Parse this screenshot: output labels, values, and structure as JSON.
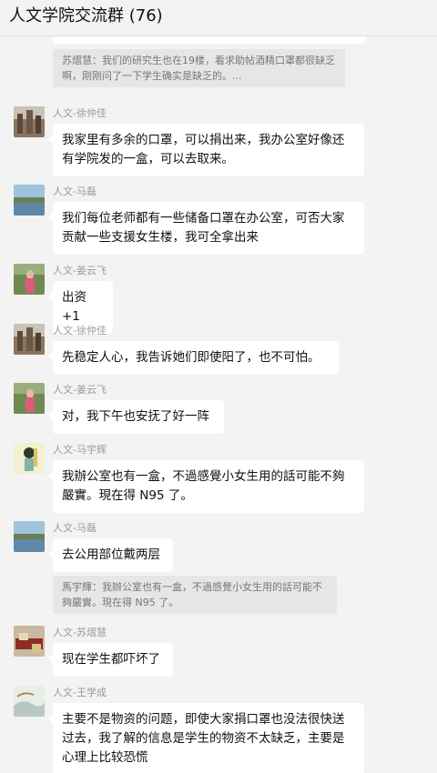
{
  "header": {
    "title": "人文学院交流群 (76)"
  },
  "quote_top": "苏熠慧：我们的研究生也在19楼，看求助帖酒精口罩都很缺乏啊，刚刚问了一下学生确实是缺乏的。...",
  "messages": [
    {
      "sender": "人文-徐仲佳",
      "text": "我家里有多余的口罩，可以捐出来，我办公室好像还有学院发的一盒，可以去取来。"
    },
    {
      "sender": "人文-马磊",
      "text": "我们每位老师都有一些储备口罩在办公室，可否大家贡献一些支援女生楼，我可全拿出来"
    },
    {
      "sender": "人文-姜云飞",
      "text": "出资+1"
    },
    {
      "sender": "人文-徐仲佳",
      "text": "先稳定人心，我告诉她们即使阳了，也不可怕。"
    },
    {
      "sender": "人文-姜云飞",
      "text": "对，我下午也安抚了好一阵"
    },
    {
      "sender": "人文-马宇辉",
      "text": "我辦公室也有一盒，不過感覺小女生用的話可能不夠嚴實。現在得 N95 了。"
    },
    {
      "sender": "人文-马磊",
      "text": "去公用部位戴两层"
    },
    {
      "sender": "人文-苏熠慧",
      "text": "现在学生都吓坏了"
    },
    {
      "sender": "人文-王学成",
      "text": "主要不是物资的问题，即使大家捐口罩也没法很快送过去，我了解的信息是学生的物资不太缺乏，主要是心理上比较恐慌"
    }
  ],
  "quote_mid": "馬宇輝：我辦公室也有一盒，不過感覺小女生用的話可能不夠嚴實。現在得 N95 了。"
}
